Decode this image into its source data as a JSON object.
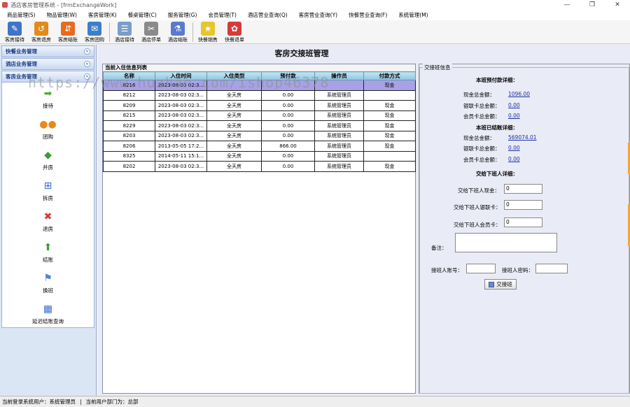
{
  "window": {
    "title": "酒店客房管理系统 - [frmExchangeWork]",
    "buttons": [
      "—",
      "❐",
      "✕"
    ]
  },
  "menu": [
    "商品管理(S)",
    "物品管理(W)",
    "客房管理(K)",
    "餐桌管理(C)",
    "服务管理(G)",
    "会员管理(T)",
    "酒店营业查询(Q)",
    "客房营业查询(Y)",
    "快餐营业查询(F)",
    "系统管理(M)"
  ],
  "toolbar": [
    {
      "label": "客房接待",
      "icon": "pen-icon",
      "color": "#3e74c9"
    },
    {
      "label": "客房退房",
      "icon": "return-icon",
      "color": "#e38a1a"
    },
    {
      "label": "客房结账",
      "icon": "checkout-icon",
      "color": "#e86a1c"
    },
    {
      "label": "客房团购",
      "icon": "group-icon",
      "color": "#3d7ec9"
    },
    {
      "label": "酒店接待",
      "icon": "id-card-icon",
      "color": "#7a9cc9"
    },
    {
      "label": "酒店停单",
      "icon": "tools-icon",
      "color": "#8a8a8a"
    },
    {
      "label": "酒店结账",
      "icon": "bottles-icon",
      "color": "#5a7ad0"
    },
    {
      "label": "快餐销售",
      "icon": "star-icon",
      "color": "#e6c62a"
    },
    {
      "label": "快餐退单",
      "icon": "gear-icon",
      "color": "#d63a3a"
    }
  ],
  "left": {
    "headers": [
      "快餐业务管理",
      "酒店业务管理",
      "客房业务管理"
    ],
    "nav": [
      {
        "label": "接待",
        "icon": "arrow-icon",
        "glyph": "➡",
        "color": "#4caf2a"
      },
      {
        "label": "团购",
        "icon": "people-icon",
        "glyph": "👥",
        "color": "#e88a1a"
      },
      {
        "label": "并房",
        "icon": "cubes-icon",
        "glyph": "◆",
        "color": "#3a9a3a"
      },
      {
        "label": "拆房",
        "icon": "network-icon",
        "glyph": "⊞",
        "color": "#3a6ad0"
      },
      {
        "label": "退房",
        "icon": "delete-doc-icon",
        "glyph": "✖",
        "color": "#d43a3a"
      },
      {
        "label": "结账",
        "icon": "arrows-icon",
        "glyph": "⬆",
        "color": "#3aa03a"
      },
      {
        "label": "换班",
        "icon": "flag-icon",
        "glyph": "⚑",
        "color": "#4a8ad0"
      },
      {
        "label": "延迟结账查询",
        "icon": "calendar-icon",
        "glyph": "▦",
        "color": "#3a6ad0"
      }
    ]
  },
  "page_title": "客房交接班管理",
  "list": {
    "caption": "当前入住信息列表",
    "columns": [
      "名称",
      "入住时间",
      "入住类型",
      "预付款",
      "操作员",
      "付款方式"
    ],
    "rows": [
      [
        "8216",
        "2023-08-03 02:3...",
        "",
        "",
        "",
        "现金"
      ],
      [
        "8212",
        "2023-08-03 02:3...",
        "全天房",
        "0.00",
        "系统管理员",
        ""
      ],
      [
        "8209",
        "2023-08-03 02:3...",
        "全天房",
        "0.00",
        "系统管理员",
        "现金"
      ],
      [
        "8215",
        "2023-08-03 02:3...",
        "全天房",
        "0.00",
        "系统管理员",
        "现金"
      ],
      [
        "8229",
        "2023-08-03 02:3...",
        "全天房",
        "0.00",
        "系统管理员",
        "现金"
      ],
      [
        "8203",
        "2023-08-03 02:3...",
        "全天房",
        "0.00",
        "系统管理员",
        "现金"
      ],
      [
        "8206",
        "2013-05-05 17:2...",
        "全天房",
        "866.00",
        "系统管理员",
        "现金"
      ],
      [
        "8325",
        "2014-05-11 15:1...",
        "全天房",
        "0.00",
        "系统管理员",
        ""
      ],
      [
        "8202",
        "2023-08-03 02:3...",
        "全天房",
        "0.00",
        "系统管理员",
        "现金"
      ]
    ]
  },
  "shift": {
    "legend": "交接班信息",
    "prepay_title": "本班预付款详细：",
    "prepay": [
      {
        "label": "现金总金额：",
        "value": "1096.00"
      },
      {
        "label": "银联卡总金额：",
        "value": "0.00"
      },
      {
        "label": "会员卡总金额：",
        "value": "0.00"
      }
    ],
    "settled_title": "本班已结账详细：",
    "settled": [
      {
        "label": "现金总金额：",
        "value": "569074.01"
      },
      {
        "label": "银联卡总金额：",
        "value": "0.00"
      },
      {
        "label": "会员卡总金额：",
        "value": "0.00"
      }
    ],
    "handover_title": "交给下班人详细：",
    "handover": [
      {
        "label": "交给下班人现金：",
        "value": "0"
      },
      {
        "label": "交给下班人银联卡：",
        "value": "0"
      },
      {
        "label": "交给下班人会员卡：",
        "value": "0"
      }
    ],
    "remark_label": "备注：",
    "receiver_label": "接班人账号：",
    "password_label": "接班人密码：",
    "button_label": "交接班"
  },
  "status": {
    "user": "当前登录系统用户：系统管理员",
    "dept": "当前用户部门为：总部"
  },
  "watermark": "https://www.huzhan.com/ishop46378"
}
